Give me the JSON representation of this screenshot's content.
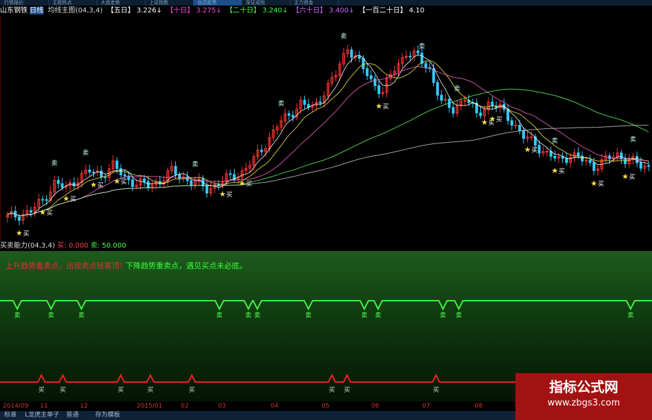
{
  "menu_tabs": [
    "行情报价",
    "主题热点",
    "大盘走势",
    "上证指数",
    "自选股票",
    "深证成指",
    "主力资金"
  ],
  "active_menu_tab": 4,
  "legend": {
    "stock_name": "山东钢铁",
    "period": "日线",
    "indicator": "均线主图(04,3,4)",
    "ma5_label": "【五日】",
    "ma5_value": "3.226↓",
    "ma10_label": "【十日】",
    "ma10_value": "3.275↓",
    "ma20_label": "【二十日】",
    "ma20_value": "3.240↓",
    "ma60_label": "【六十日】",
    "ma60_value": "3.400↓",
    "ma120_label": "【一百二十日】",
    "ma120_value": "4.10"
  },
  "sub_header": {
    "name": "买卖能力(04,3,4)",
    "buy_label": "买:",
    "buy_value": "0.000",
    "sell_label": "卖:",
    "sell_value": "50.000"
  },
  "sub_text": {
    "red": "上升趋势看卖点，出现卖点轻客顶！",
    "green": "下降趋势重卖点，遇见买点未必底。"
  },
  "signal_labels": {
    "buy": "买",
    "sell": "卖"
  },
  "dates": [
    "2014/09",
    "11",
    "12",
    "2015/01",
    "02",
    "03",
    "04",
    "05",
    "06",
    "07",
    "08"
  ],
  "bottom_tabs": [
    "标准",
    "L龙虎主单子",
    "普通",
    "存为模板"
  ],
  "watermark": {
    "title": "指标公式网",
    "url": "www.zbgs3.com"
  },
  "colors": {
    "up": "#ff3333",
    "down": "#33ccff",
    "ma5": "#ffffff",
    "ma10": "#ffee44",
    "ma20": "#ff66cc",
    "ma60": "#66ff66",
    "ma120": "#cccccc",
    "sell_line": "#44ee44",
    "buy_line": "#ee2222"
  },
  "chart_data": {
    "type": "candlestick",
    "price_series_approx": [
      2.6,
      2.65,
      2.7,
      2.9,
      3.2,
      3.1,
      3.3,
      3.4,
      3.35,
      3.5,
      3.3,
      3.2,
      3.15,
      3.25,
      3.4,
      3.3,
      3.2,
      3.1,
      3.2,
      3.3,
      3.4,
      3.6,
      3.9,
      4.2,
      4.4,
      4.6,
      4.5,
      4.8,
      5.1,
      5.6,
      5.3,
      5.0,
      4.8,
      5.2,
      5.5,
      5.4,
      5.2,
      4.6,
      4.5,
      4.7,
      4.4,
      4.6,
      4.5,
      4.3,
      4.0,
      3.9,
      3.7,
      3.6,
      3.7,
      3.6,
      3.5,
      3.6,
      3.7,
      3.6,
      3.5
    ]
  }
}
